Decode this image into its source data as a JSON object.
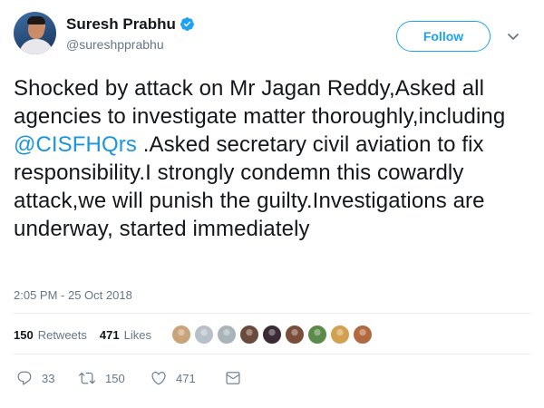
{
  "author": {
    "name": "Suresh Prabhu",
    "handle": "@sureshpprabhu",
    "verified": true
  },
  "header": {
    "follow_label": "Follow",
    "caret_icon": "chevron-down-icon"
  },
  "tweet": {
    "text_before": "Shocked by attack on Mr Jagan Reddy,Asked all agencies to investigate matter thoroughly,including ",
    "mention": "@CISFHQrs",
    "text_after": " .Asked secretary civil aviation to fix responsibility.I strongly condemn this cowardly attack,we will punish the guilty.Investigations are underway, started immediately",
    "timestamp": "2:05 PM - 25 Oct 2018"
  },
  "stats": {
    "retweets_count": "150",
    "retweets_label": "Retweets",
    "likes_count": "471",
    "likes_label": "Likes"
  },
  "actions": {
    "reply_count": "33",
    "retweet_count": "150",
    "like_count": "471"
  },
  "colors": {
    "accent": "#1da1f2",
    "mention": "#1b95e0",
    "secondary_text": "#657786",
    "divider": "#e6ecf0"
  },
  "likers": [
    {
      "name": "liker-avatar",
      "color": "#c9a37a"
    },
    {
      "name": "liker-avatar",
      "color": "#b7c0c8"
    },
    {
      "name": "liker-avatar",
      "color": "#a8b3ba"
    },
    {
      "name": "liker-avatar",
      "color": "#6b4a3c"
    },
    {
      "name": "liker-avatar",
      "color": "#3b2b36"
    },
    {
      "name": "liker-avatar",
      "color": "#7a4e3a"
    },
    {
      "name": "liker-avatar",
      "color": "#5c8a4a"
    },
    {
      "name": "liker-avatar",
      "color": "#d2a04e"
    },
    {
      "name": "liker-avatar",
      "color": "#b3693f"
    }
  ]
}
